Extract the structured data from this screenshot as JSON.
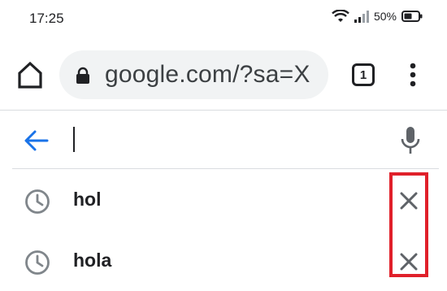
{
  "status_bar": {
    "time": "17:25",
    "battery": "50%"
  },
  "toolbar": {
    "url": "google.com/?sa=X",
    "tab_count": "1"
  },
  "search": {
    "value": "",
    "placeholder": ""
  },
  "suggestions": [
    {
      "text": "hol",
      "icon": "history-icon",
      "action": "remove-icon"
    },
    {
      "text": "hola",
      "icon": "history-icon",
      "action": "remove-icon"
    }
  ],
  "colors": {
    "accent": "#1a73e8",
    "omnibox_bg": "#f1f3f4",
    "icon_gray": "#5f6368",
    "highlight": "#e0202a"
  }
}
